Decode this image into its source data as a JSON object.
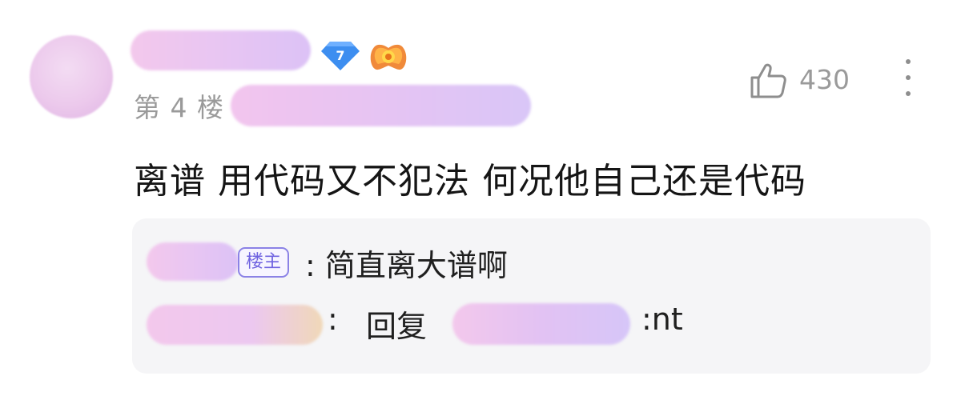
{
  "post": {
    "floor": "第 4 楼",
    "level": "7",
    "like_count": "430",
    "comment_text": "离谱 用代码又不犯法 何况他自己还是代码"
  },
  "replies": [
    {
      "badge": "楼主",
      "text": ": 简直离大谱啊"
    },
    {
      "colon": ":",
      "label": "回复",
      "tail": ":nt"
    }
  ],
  "colors": {
    "accent_purple": "#6f63e0",
    "level_blue": "#3d8ef0",
    "muted_text": "#9a9a9a",
    "reply_bg": "#f5f5f7"
  },
  "icons": [
    "user-avatar",
    "level-badge",
    "game-badge",
    "thumbs-up-icon",
    "more-vertical-icon"
  ]
}
